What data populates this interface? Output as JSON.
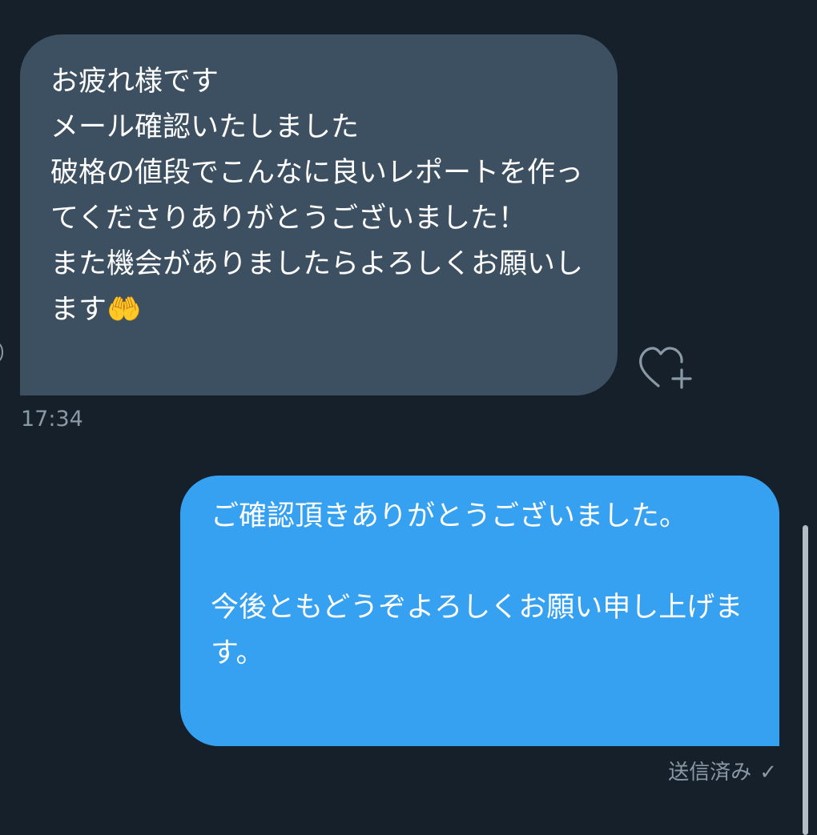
{
  "conversation": {
    "incoming": {
      "text": "お疲れ様です\nメール確認いたしました\n破格の値段でこんなに良いレポートを作ってくださりありがとうございました！\nまた機会がありましたらよろしくお願いします🤲",
      "time": "17:34",
      "bubble_color": "#3d5061"
    },
    "outgoing": {
      "text": "ご確認頂きありがとうございました。\n\n今後ともどうぞよろしくお願い申し上げます。",
      "status": "送信済み",
      "status_icon": "check-icon",
      "bubble_color": "#36a0f1"
    },
    "like_icon": "heart-plus-icon"
  },
  "theme": {
    "background": "#16202b",
    "muted_text": "#8a99a6"
  }
}
